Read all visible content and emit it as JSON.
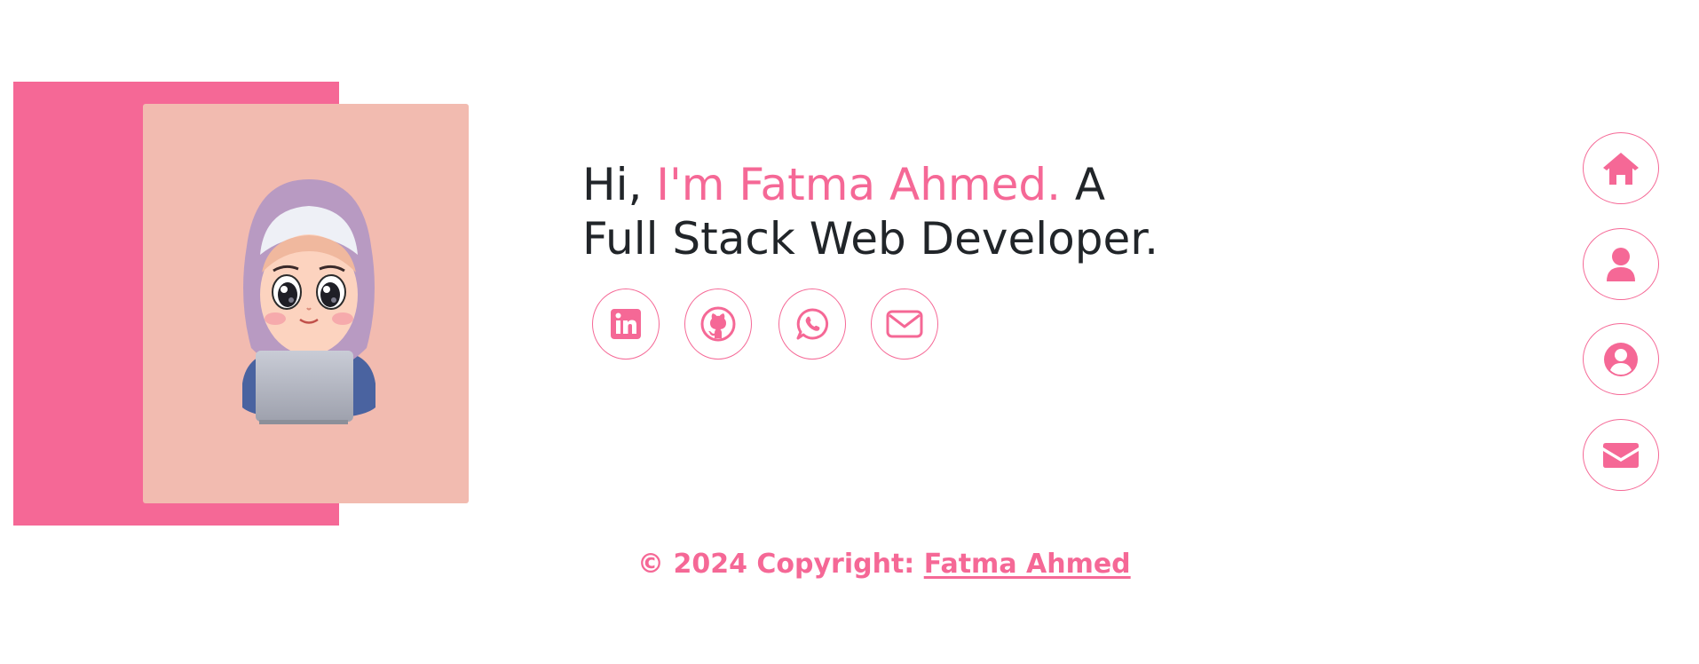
{
  "hero": {
    "greeting": "Hi, ",
    "name_line": "I'm Fatma Ahmed.",
    "role_word": " A",
    "role_line": "Full Stack Web Developer."
  },
  "socials": [
    {
      "name": "linkedin",
      "icon": "linkedin-icon"
    },
    {
      "name": "github",
      "icon": "github-icon"
    },
    {
      "name": "whatsapp",
      "icon": "whatsapp-icon"
    },
    {
      "name": "email",
      "icon": "envelope-outline-icon"
    }
  ],
  "side_nav": [
    {
      "name": "home",
      "icon": "home-icon"
    },
    {
      "name": "about",
      "icon": "user-icon"
    },
    {
      "name": "profile",
      "icon": "user-circle-icon"
    },
    {
      "name": "contact",
      "icon": "envelope-icon"
    }
  ],
  "footer": {
    "copyright": "© 2024 Copyright: ",
    "author_link": "Fatma Ahmed"
  },
  "colors": {
    "accent": "#f56896",
    "card": "#f2bbb0",
    "text": "#212529"
  }
}
